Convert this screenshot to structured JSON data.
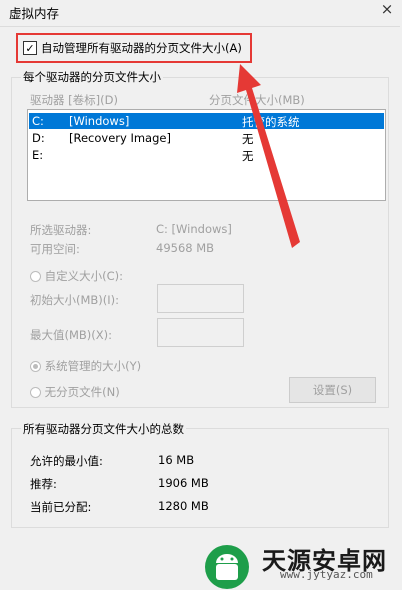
{
  "window": {
    "title": "虚拟内存",
    "close_icon": "×"
  },
  "auto_manage": {
    "label": "自动管理所有驱动器的分页文件大小(A)",
    "checked": true,
    "check_mark": "✓"
  },
  "drives_group": {
    "legend": "每个驱动器的分页文件大小",
    "col_drive": "驱动器 [卷标](D)",
    "col_size": "分页文件大小(MB)",
    "rows": [
      {
        "drive": "C:",
        "label": "[Windows]",
        "size": "托管的系统",
        "selected": true
      },
      {
        "drive": "D:",
        "label": "[Recovery Image]",
        "size": "无",
        "selected": false
      },
      {
        "drive": "E:",
        "label": "",
        "size": "无",
        "selected": false
      }
    ],
    "selected_drive_label": "所选驱动器:",
    "selected_drive_value": "C:  [Windows]",
    "free_space_label": "可用空间:",
    "free_space_value": "49568 MB",
    "custom_size_label": "自定义大小(C):",
    "initial_size_label": "初始大小(MB)(I):",
    "max_size_label": "最大值(MB)(X):",
    "system_managed_label": "系统管理的大小(Y)",
    "no_paging_label": "无分页文件(N)",
    "set_button": "设置(S)"
  },
  "totals_group": {
    "legend": "所有驱动器分页文件大小的总数",
    "min_label": "允许的最小值:",
    "min_value": "16 MB",
    "recommended_label": "推荐:",
    "recommended_value": "1906 MB",
    "current_label": "当前已分配:",
    "current_value": "1280 MB"
  },
  "watermark": {
    "name": "天源安卓网",
    "url": "www.jytyaz.com"
  },
  "colors": {
    "selection": "#0078d7",
    "annotation": "#e53935",
    "logo": "#1e9e4a"
  }
}
